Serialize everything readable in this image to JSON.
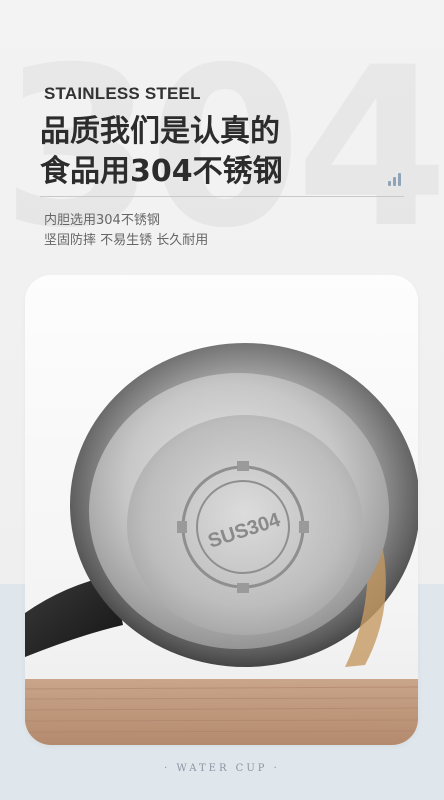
{
  "watermark": "304",
  "header": {
    "kicker": "STAINLESS STEEL",
    "headline_line1": "品质我们是认真的",
    "headline_line2": "食品用304不锈钢"
  },
  "icons": {
    "signal": "bars-icon"
  },
  "features": {
    "line1": "内胆选用304不锈钢",
    "line2": "坚固防摔 不易生锈 长久耐用"
  },
  "product_photo": {
    "emboss_text": "SUS304"
  },
  "footer": {
    "caption": "· WATER CUP ·"
  },
  "colors": {
    "accent_blue": "#dfe6ec",
    "headline": "#2c2c2c"
  }
}
